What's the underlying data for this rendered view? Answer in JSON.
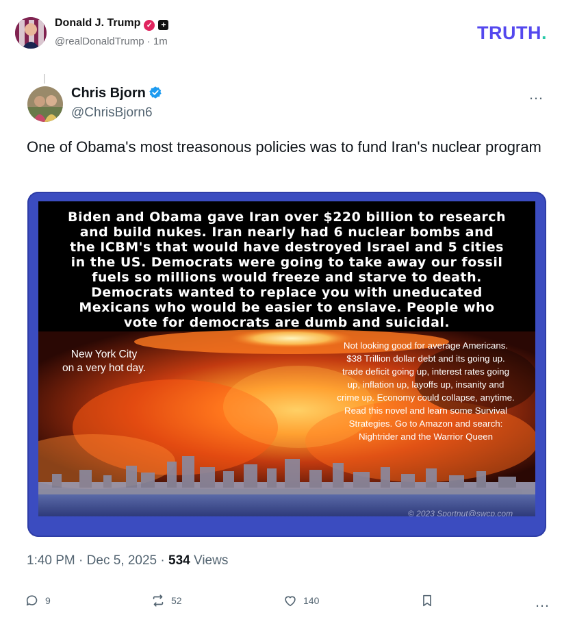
{
  "poster": {
    "name": "Donald J. Trump",
    "handle": "@realDonaldTrump",
    "time": "1m"
  },
  "brand": {
    "logo": "TRUTH",
    "logo_dot": ".",
    "color": "#5448ee",
    "dot_color": "#28c9a8"
  },
  "quoted": {
    "name": "Chris Bjorn",
    "handle": "@ChrisBjorn6",
    "text": "One of Obama's most treasonous policies was to fund Iran's nuclear program",
    "more_icon": "…"
  },
  "meme": {
    "headline": [
      "Biden and Obama gave Iran over $220 billion to research",
      "and build nukes.  Iran nearly had 6 nuclear bombs and",
      "the ICBM's that would have destroyed Israel and 5 cities",
      "in the US.  Democrats were going to take away our fossil",
      "fuels so millions would freeze and starve to death.",
      "Democrats wanted to replace you with uneducated",
      "Mexicans who would be easier to enslave.  People who",
      "vote for democrats are dumb and suicidal."
    ],
    "left_caption": [
      "New York City",
      "on a very hot day."
    ],
    "right_caption": [
      "Not looking good for average Americans.",
      "$38 Trillion dollar debt and its going up.",
      "trade deficit going up, interest rates going",
      "up, inflation up, layoffs up, insanity and",
      "crime up.  Economy could collapse, anytime.",
      "Read this novel and learn some Survival",
      "Strategies. Go to Amazon and search:",
      "Nightrider and the Warrior Queen"
    ],
    "copyright": "© 2023 Sportnut@swcp.com"
  },
  "meta": {
    "time": "1:40 PM",
    "date": "Dec 5, 2025",
    "views_count": "534",
    "views_label": "Views"
  },
  "actions": {
    "replies": "9",
    "reposts": "52",
    "likes": "140"
  }
}
